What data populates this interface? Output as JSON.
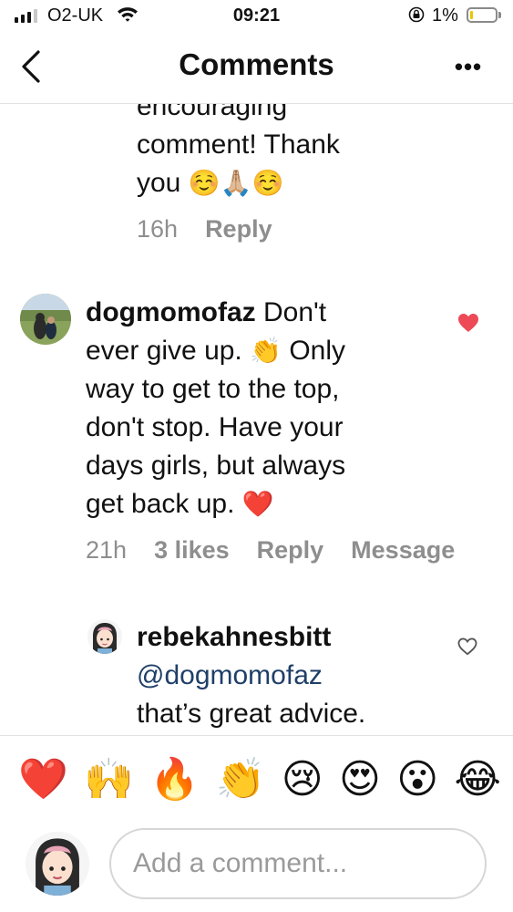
{
  "status_bar": {
    "carrier": "O2-UK",
    "time": "09:21",
    "battery_percent": "1%",
    "battery_level": 0.01,
    "signal_bars": 3
  },
  "header": {
    "title": "Comments",
    "more_label": "•••"
  },
  "comments": [
    {
      "text_lines": [
        "encouraging",
        "comment! Thank",
        "you"
      ],
      "emojis": "☺️🙏🏼☺️",
      "time": "16h",
      "reply_label": "Reply"
    },
    {
      "username": "dogmomofaz",
      "text_first": " Don't",
      "text_lines": [
        "ever give up.",
        "way to get to the top,",
        "don't stop. Have your",
        "days girls, but always",
        "get back up."
      ],
      "clap_emoji": "👏",
      "after_clap": " Only",
      "heart_emoji": "❤️",
      "time": "21h",
      "likes": "3 likes",
      "reply_label": "Reply",
      "message_label": "Message",
      "liked": true
    },
    {
      "username": "rebekahnesbitt",
      "mention": "@dogmomofaz",
      "text_lines": [
        "that’s great advice."
      ],
      "liked": false
    }
  ],
  "reactions": [
    "❤️",
    "🙌",
    "🔥",
    "👏",
    "😢",
    "😍",
    "😮",
    "😂"
  ],
  "composer": {
    "placeholder": "Add a comment..."
  },
  "colors": {
    "like_red": "#ed4956",
    "mention_blue": "#1f3f69",
    "meta_gray": "#8e8e8e"
  }
}
